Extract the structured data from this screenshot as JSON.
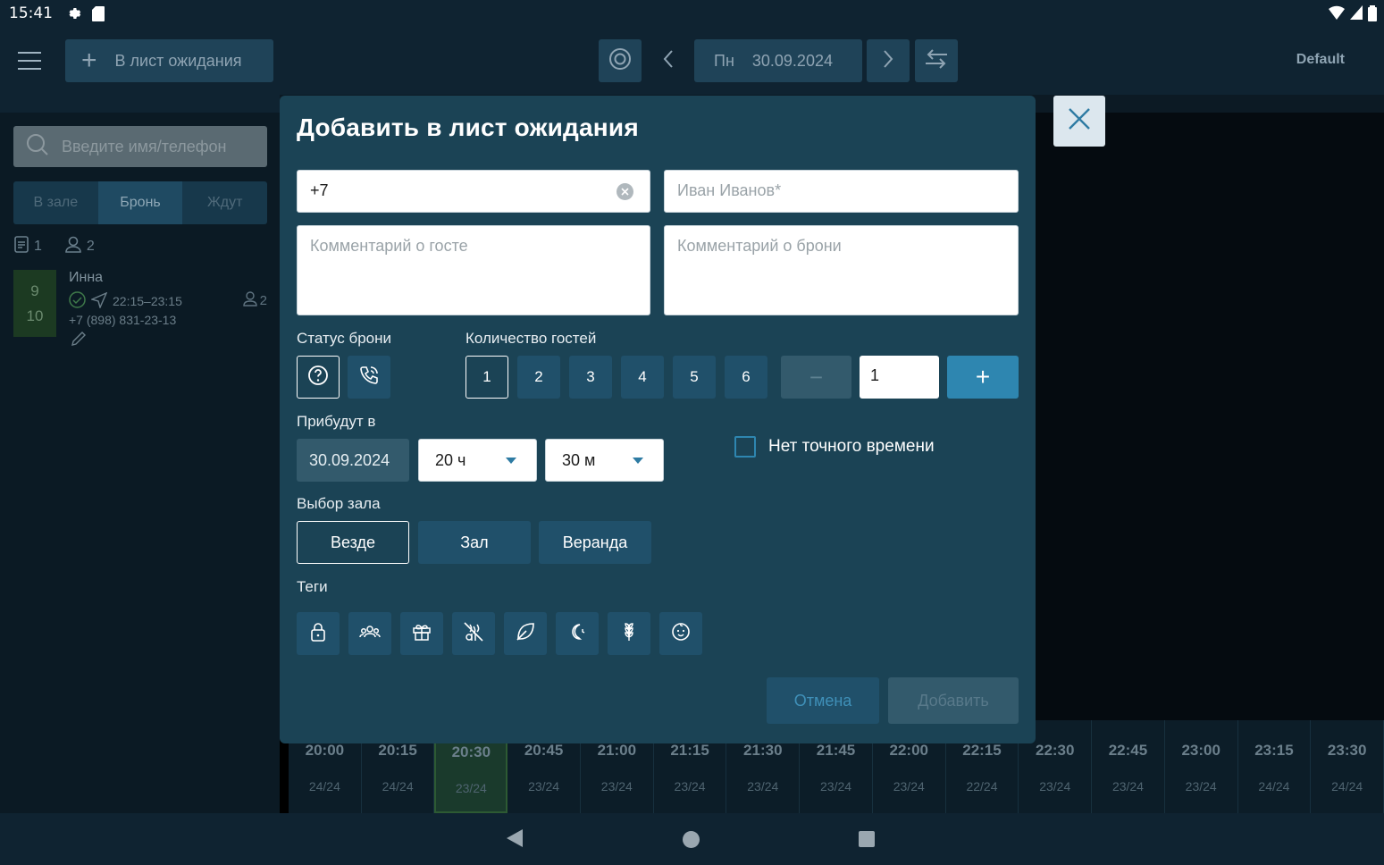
{
  "status_bar": {
    "time": "15:41"
  },
  "app_bar": {
    "waitlist_button": "В лист ожидания",
    "day": "Пн",
    "date": "30.09.2024",
    "profile": "Default"
  },
  "sidebar": {
    "search_placeholder": "Введите имя/телефон",
    "tabs": [
      "В зале",
      "Бронь",
      "Ждут"
    ],
    "active_tab": "Бронь",
    "booking_count": "1",
    "guest_count": "2",
    "booking": {
      "tables": [
        "9",
        "10"
      ],
      "name": "Инна",
      "time": "22:15–23:15",
      "phone": "+7 (898) 831-23-13",
      "persons": "2"
    }
  },
  "modal": {
    "title": "Добавить в лист ожидания",
    "phone_value": "+7",
    "name_placeholder": "Иван Иванов*",
    "guest_comment_placeholder": "Комментарий о госте",
    "booking_comment_placeholder": "Комментарий о брони",
    "status_label": "Статус брони",
    "guests_label": "Количество гостей",
    "guest_options": [
      "1",
      "2",
      "3",
      "4",
      "5",
      "6"
    ],
    "selected_guests": "1",
    "guests_input": "1",
    "minus": "−",
    "plus": "+",
    "arrive_label": "Прибудут в",
    "arrive_date": "30.09.2024",
    "hour": "20 ч",
    "minute": "30 м",
    "no_exact_time": "Нет точного времени",
    "hall_label": "Выбор зала",
    "halls": [
      "Везде",
      "Зал",
      "Веранда"
    ],
    "selected_hall": "Везде",
    "tags_label": "Теги",
    "tags": [
      "lock-icon",
      "group-icon",
      "gift-icon",
      "no-gluten-icon",
      "leaf-icon",
      "moon-icon",
      "wheat-icon",
      "baby-icon"
    ],
    "cancel": "Отмена",
    "add": "Добавить"
  },
  "timeline": {
    "slots": [
      {
        "time": "20:00",
        "seats": "24/24"
      },
      {
        "time": "20:15",
        "seats": "24/24"
      },
      {
        "time": "20:30",
        "seats": "23/24"
      },
      {
        "time": "20:45",
        "seats": "23/24"
      },
      {
        "time": "21:00",
        "seats": "23/24"
      },
      {
        "time": "21:15",
        "seats": "23/24"
      },
      {
        "time": "21:30",
        "seats": "23/24"
      },
      {
        "time": "21:45",
        "seats": "23/24"
      },
      {
        "time": "22:00",
        "seats": "23/24"
      },
      {
        "time": "22:15",
        "seats": "22/24"
      },
      {
        "time": "22:30",
        "seats": "23/24"
      },
      {
        "time": "22:45",
        "seats": "23/24"
      },
      {
        "time": "23:00",
        "seats": "23/24"
      },
      {
        "time": "23:15",
        "seats": "24/24"
      },
      {
        "time": "23:30",
        "seats": "24/24"
      }
    ],
    "selected": "20:30"
  },
  "colors": {
    "modal_bg": "#1b4355",
    "accent": "#2e86b0",
    "button_bg": "#20506a",
    "appbar_bg": "#0f2331"
  }
}
